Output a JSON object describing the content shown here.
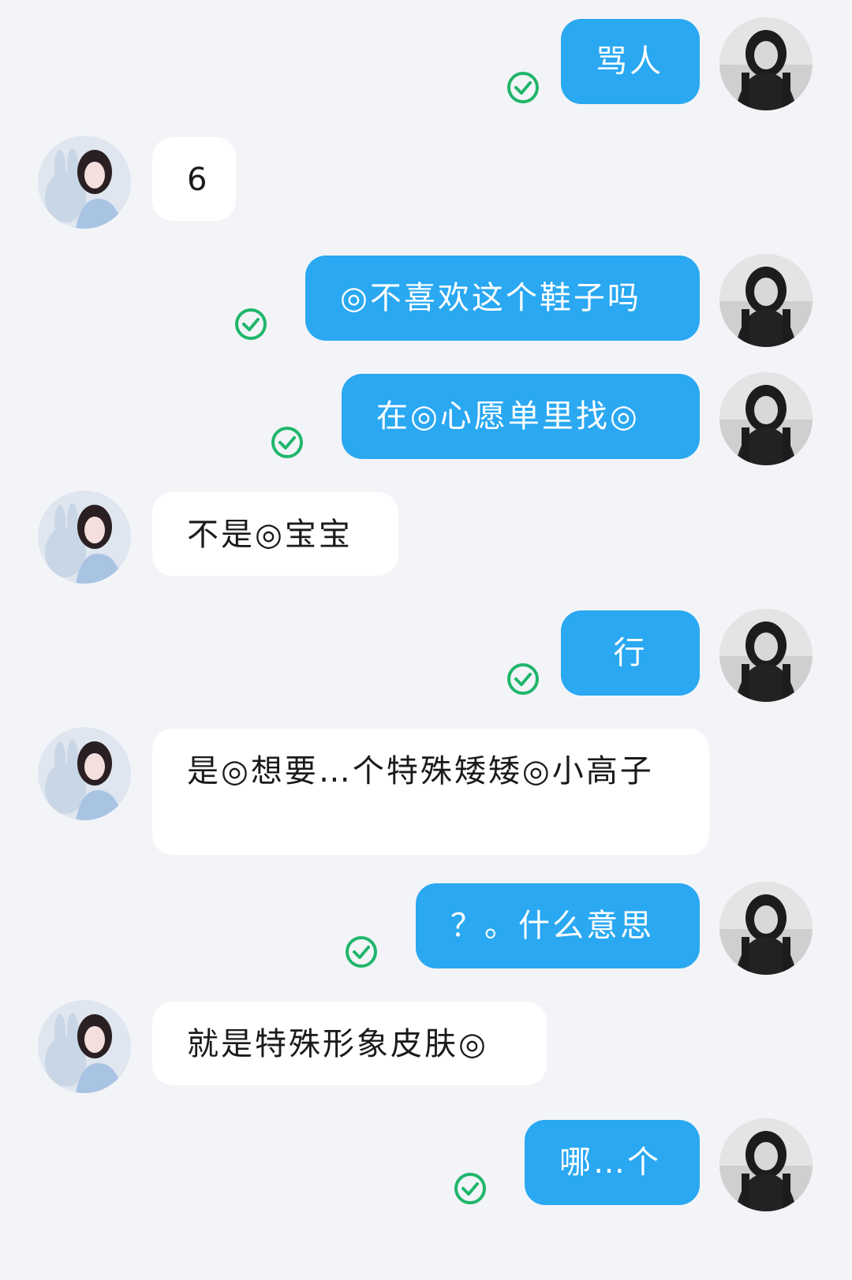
{
  "colors": {
    "background": "#f3f4f8",
    "outgoing_bubble": "#2aa8f2",
    "incoming_bubble": "#ffffff",
    "read_check": "#1fb66b"
  },
  "messages": [
    {
      "side": "me",
      "text": "骂人",
      "read": true
    },
    {
      "side": "them",
      "text": "6"
    },
    {
      "side": "me",
      "text": "◎不喜欢这个鞋子吗",
      "read": true
    },
    {
      "side": "me",
      "text": "在◎心愿单里找◎",
      "read": true
    },
    {
      "side": "them",
      "text": "不是◎宝宝"
    },
    {
      "side": "me",
      "text": "行",
      "read": true
    },
    {
      "side": "them",
      "text": "是◎想要…个特殊矮矮◎小高子"
    },
    {
      "side": "me",
      "text": "？。什么意思",
      "read": true
    },
    {
      "side": "them",
      "text": "就是特殊形象皮肤◎"
    },
    {
      "side": "me",
      "text": "哪…个",
      "read": true
    }
  ]
}
